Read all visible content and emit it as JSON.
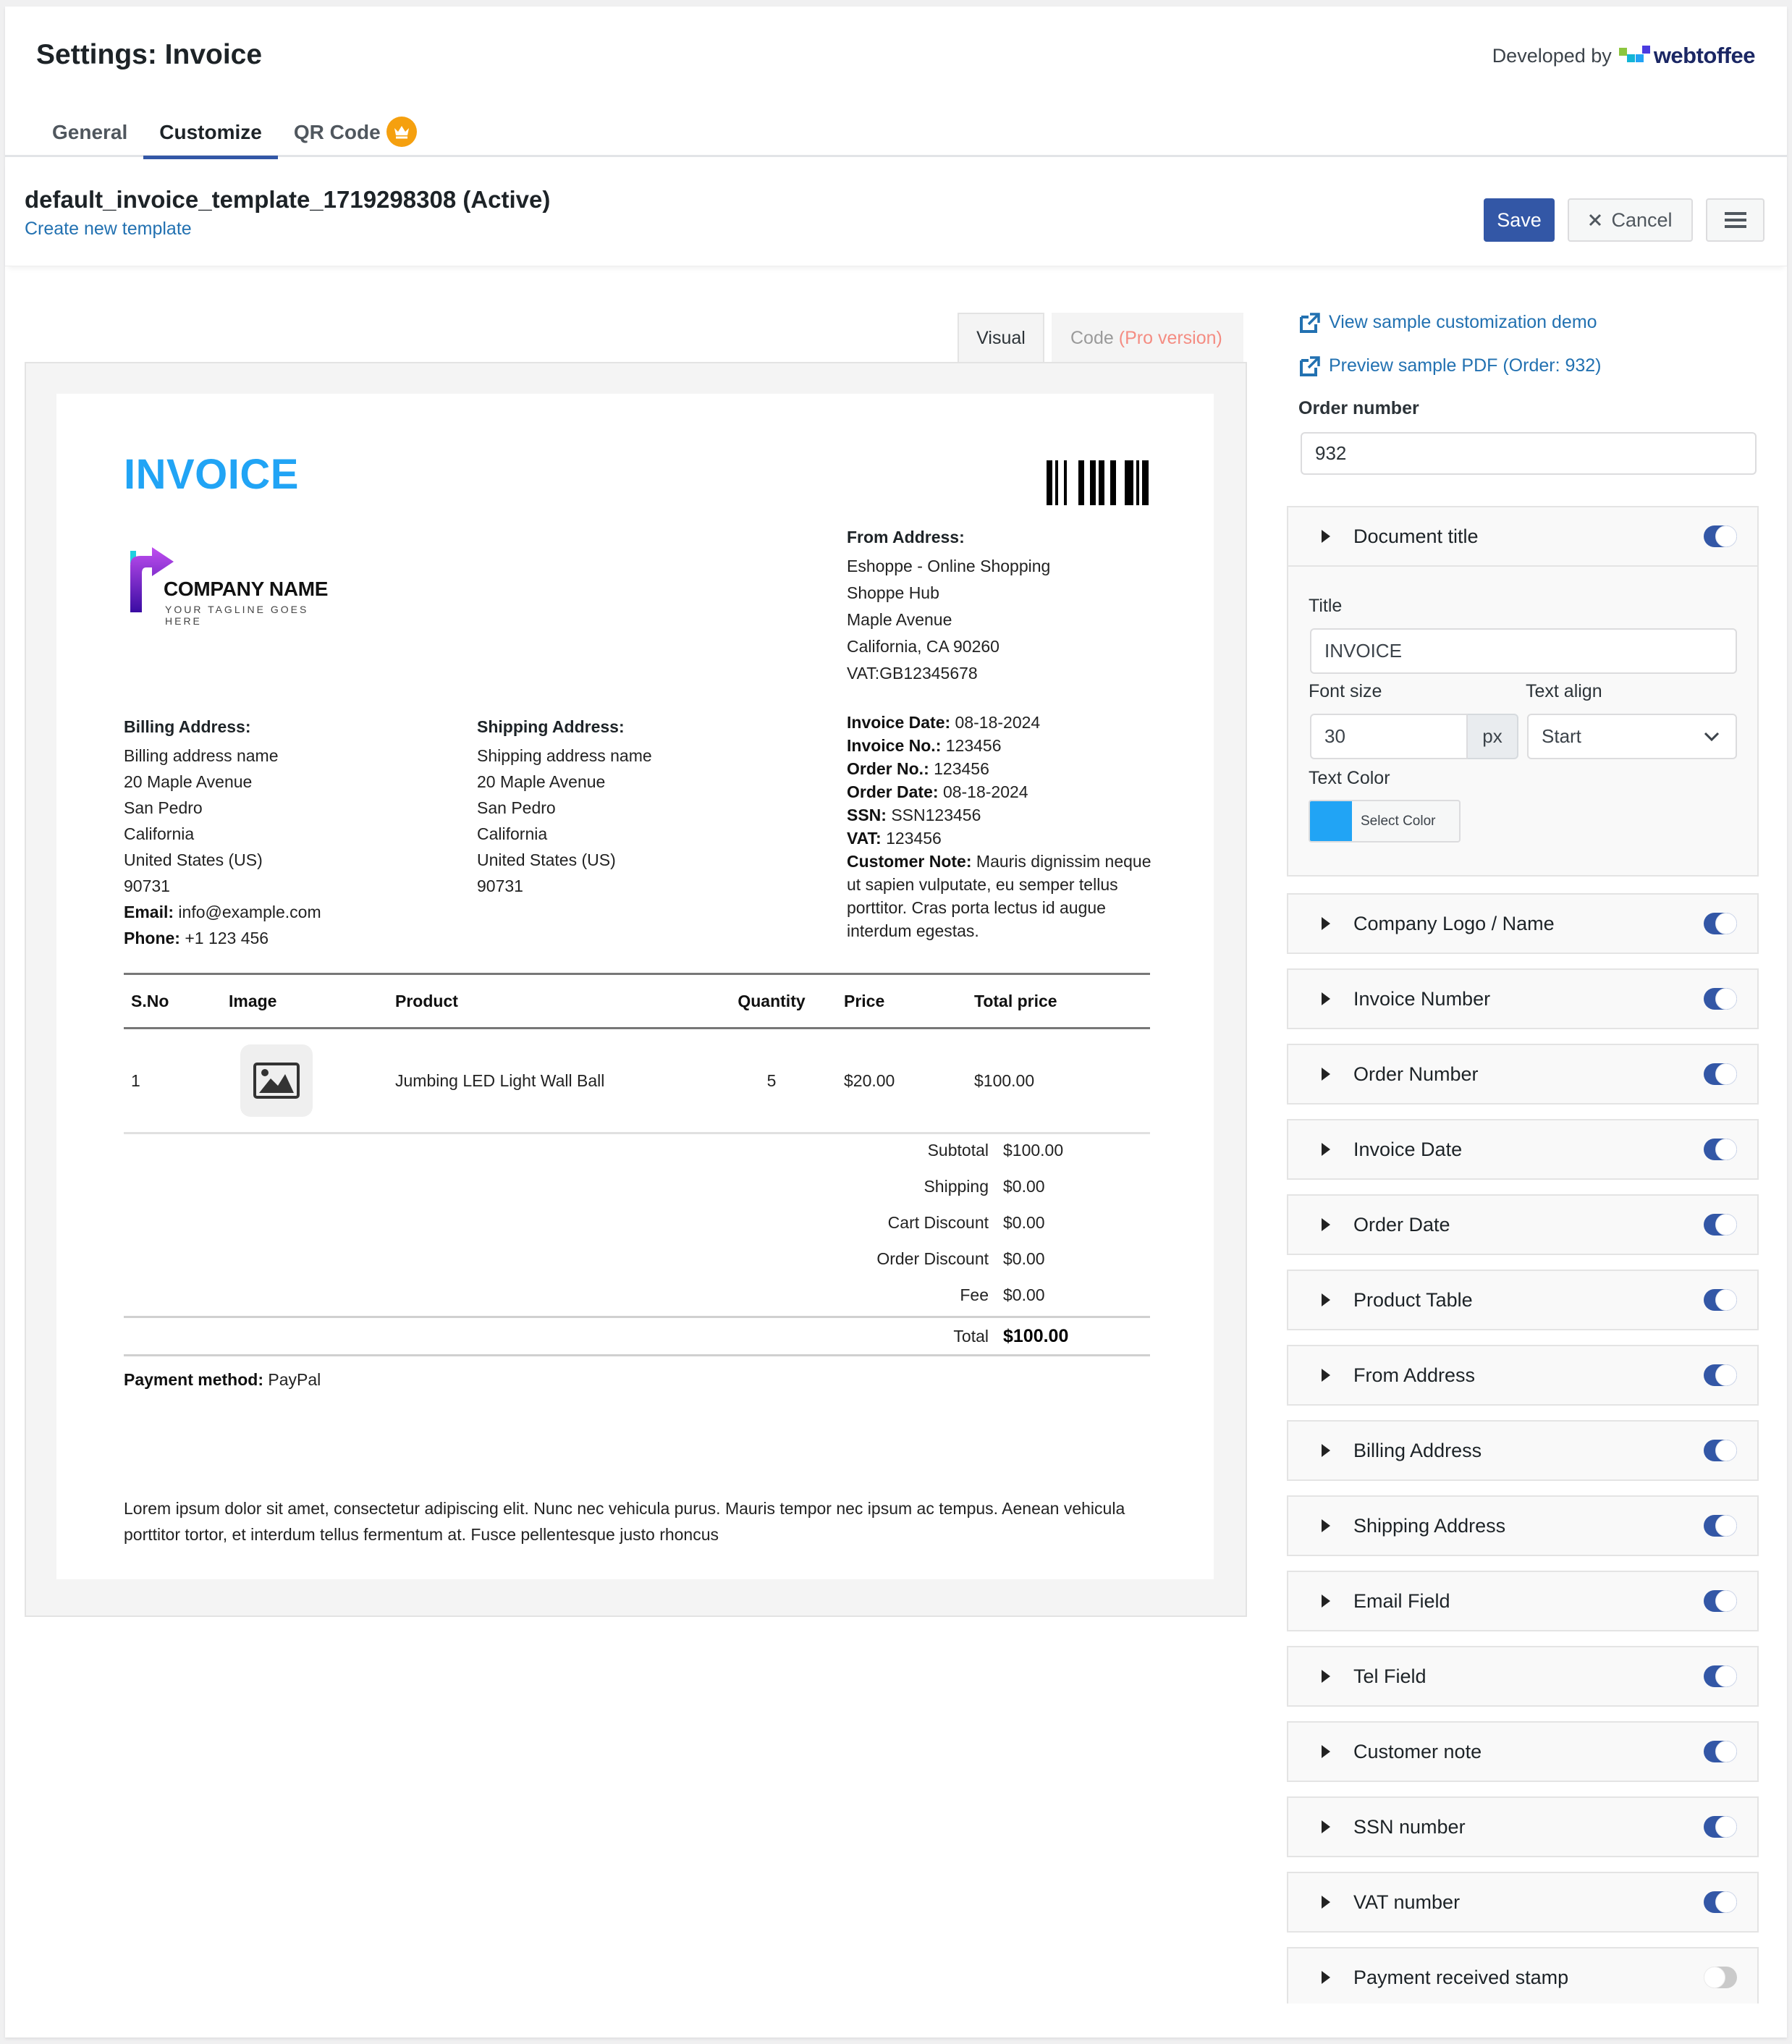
{
  "header": {
    "title": "Settings: Invoice",
    "developed_by": "Developed by",
    "brand": "webtoffee",
    "brand_colors": [
      "#8cc63e",
      "#13b5d6",
      "#22a3f5",
      "#4a3be0"
    ]
  },
  "tabs": [
    {
      "label": "General",
      "active": false
    },
    {
      "label": "Customize",
      "active": true
    },
    {
      "label": "QR Code",
      "active": false,
      "badge": "crown-icon"
    }
  ],
  "template": {
    "name": "default_invoice_template_1719298308 (Active)",
    "create_link": "Create new template",
    "save_label": "Save",
    "cancel_label": "Cancel"
  },
  "editor_tabs": {
    "visual": "Visual",
    "code": "Code",
    "code_pro": "(Pro version)"
  },
  "invoice": {
    "title": "INVOICE",
    "title_color": "#21a4f5",
    "company_name": "COMPANY NAME",
    "tagline": "YOUR TAGLINE GOES HERE",
    "from_address": {
      "heading": "From Address:",
      "lines": [
        "Eshoppe - Online Shopping",
        "Shoppe Hub",
        "Maple Avenue",
        "California, CA 90260",
        "VAT:GB12345678"
      ]
    },
    "billing_address": {
      "heading": "Billing Address:",
      "lines": [
        "Billing address name",
        "20 Maple Avenue",
        "San Pedro",
        "California",
        "United States (US)",
        "90731"
      ],
      "email_label": "Email:",
      "email": "info@example.com",
      "phone_label": "Phone:",
      "phone": "+1 123 456"
    },
    "shipping_address": {
      "heading": "Shipping Address:",
      "lines": [
        "Shipping address name",
        "20 Maple Avenue",
        "San Pedro",
        "California",
        "United States (US)",
        "90731"
      ]
    },
    "meta": {
      "invoice_date_label": "Invoice Date:",
      "invoice_date": "08-18-2024",
      "invoice_no_label": "Invoice No.:",
      "invoice_no": "123456",
      "order_no_label": "Order No.:",
      "order_no": "123456",
      "order_date_label": "Order Date:",
      "order_date": "08-18-2024",
      "ssn_label": "SSN:",
      "ssn": "SSN123456",
      "vat_label": "VAT:",
      "vat": "123456",
      "customer_note_label": "Customer Note:",
      "customer_note": "Mauris dignissim neque ut sapien vulputate, eu semper tellus porttitor. Cras porta lectus id augue interdum egestas."
    },
    "table": {
      "headers": [
        "S.No",
        "Image",
        "Product",
        "Quantity",
        "Price",
        "Total price"
      ],
      "rows": [
        {
          "sno": "1",
          "image": "image-placeholder-icon",
          "product": "Jumbing LED Light Wall Ball",
          "quantity": "5",
          "price": "$20.00",
          "total": "$100.00"
        }
      ]
    },
    "totals": [
      {
        "label": "Subtotal",
        "value": "$100.00"
      },
      {
        "label": "Shipping",
        "value": "$0.00"
      },
      {
        "label": "Cart Discount",
        "value": "$0.00"
      },
      {
        "label": "Order Discount",
        "value": "$0.00"
      },
      {
        "label": "Fee",
        "value": "$0.00"
      }
    ],
    "total": {
      "label": "Total",
      "value": "$100.00"
    },
    "payment_method_label": "Payment method:",
    "payment_method": "PayPal",
    "footer": "Lorem ipsum dolor sit amet, consectetur adipiscing elit. Nunc nec vehicula purus. Mauris tempor nec ipsum ac tempus. Aenean vehicula porttitor tortor, et interdum tellus fermentum at. Fusce pellentesque justo rhoncus"
  },
  "right_panel": {
    "demo_link": "View sample customization demo",
    "preview_link": "Preview sample PDF (Order: 932)",
    "order_number_label": "Order number",
    "order_number_value": "932",
    "document_title": {
      "label": "Document title",
      "enabled": true,
      "title_label": "Title",
      "title_value": "INVOICE",
      "font_size_label": "Font size",
      "font_size_value": "30",
      "font_size_unit": "px",
      "text_align_label": "Text align",
      "text_align_value": "Start",
      "text_color_label": "Text Color",
      "text_color_value": "#21a4f5",
      "select_color_label": "Select Color"
    },
    "sections": [
      {
        "label": "Company Logo / Name",
        "enabled": true
      },
      {
        "label": "Invoice Number",
        "enabled": true
      },
      {
        "label": "Order Number",
        "enabled": true
      },
      {
        "label": "Invoice Date",
        "enabled": true
      },
      {
        "label": "Order Date",
        "enabled": true
      },
      {
        "label": "Product Table",
        "enabled": true
      },
      {
        "label": "From Address",
        "enabled": true
      },
      {
        "label": "Billing Address",
        "enabled": true
      },
      {
        "label": "Shipping Address",
        "enabled": true
      },
      {
        "label": "Email Field",
        "enabled": true
      },
      {
        "label": "Tel Field",
        "enabled": true
      },
      {
        "label": "Customer note",
        "enabled": true
      },
      {
        "label": "SSN number",
        "enabled": true
      },
      {
        "label": "VAT number",
        "enabled": true
      },
      {
        "label": "Payment received stamp",
        "enabled": false
      }
    ]
  },
  "colors": {
    "primary": "#3357a6",
    "link": "#2271b1",
    "crown_badge": "#f5a00f",
    "pro_text": "#f48c82"
  }
}
